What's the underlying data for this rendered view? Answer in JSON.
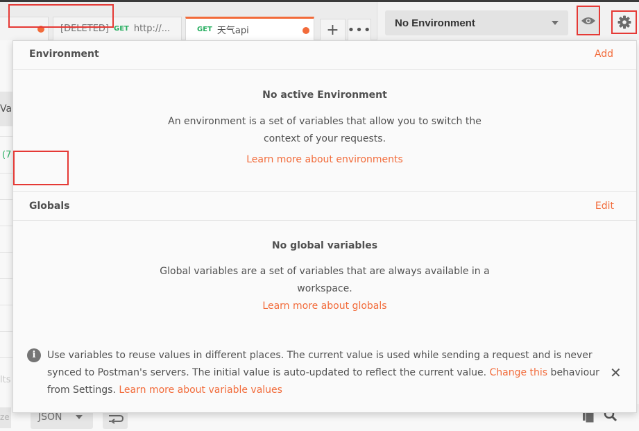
{
  "tabs": [
    {
      "method": "",
      "name": "",
      "deleted_prefix": "",
      "unsaved": true
    },
    {
      "method": "GET",
      "name": "http://...",
      "deleted_prefix": "[DELETED]",
      "unsaved": false
    },
    {
      "method": "GET",
      "name": "天气api",
      "deleted_prefix": "",
      "unsaved": true
    }
  ],
  "tab_actions": {
    "new_tab_label": "+",
    "more_label": "•••"
  },
  "environment_selector": {
    "selected": "No Environment"
  },
  "background": {
    "tab_fragment": "Vap",
    "status_fragment": "(7",
    "results_fragment": "lts",
    "beautify_fragment": "ze",
    "format_select": "JSON"
  },
  "popup": {
    "environment_section": {
      "title": "Environment",
      "action": "Add",
      "empty_title": "No active Environment",
      "empty_desc_line1": "An environment is a set of variables that allow you to switch the",
      "empty_desc_line2": "context of your requests.",
      "learn_more": "Learn more about environments"
    },
    "globals_section": {
      "title": "Globals",
      "action": "Edit",
      "empty_title": "No global variables",
      "empty_desc_line1": "Global variables are a set of variables that are always available in a",
      "empty_desc_line2": "workspace.",
      "learn_more": "Learn more about globals"
    },
    "info_banner": {
      "text_part1": "Use variables to reuse values in different places. The current value is used while sending a request and is never synced to Postman's servers. The initial value is auto-updated to reflect the current value. ",
      "change_link": "Change this",
      "text_part2": " behaviour from Settings. ",
      "learn_link": "Learn more about variable values",
      "close_label": "✕"
    }
  },
  "colors": {
    "accent": "#f26b3a",
    "get_method": "#27ae60",
    "highlight_box": "#e53935"
  },
  "icons": {
    "eye": "eye-icon",
    "gear": "gear-icon",
    "info": "info-icon",
    "close": "close-icon",
    "search": "search-icon",
    "copy": "copy-icon",
    "wrap": "wrap-icon"
  }
}
